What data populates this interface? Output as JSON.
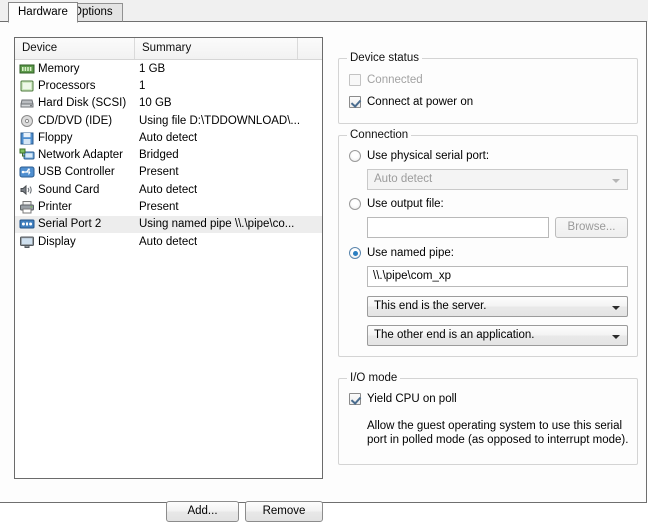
{
  "tabs": [
    {
      "label": "Hardware",
      "active": true
    },
    {
      "label": "Options",
      "active": false
    }
  ],
  "device_list": {
    "columns": [
      "Device",
      "Summary"
    ],
    "rows": [
      {
        "icon": "memory-icon",
        "device": "Memory",
        "summary": "1 GB"
      },
      {
        "icon": "processor-icon",
        "device": "Processors",
        "summary": "1"
      },
      {
        "icon": "hard-disk-icon",
        "device": "Hard Disk (SCSI)",
        "summary": "10 GB"
      },
      {
        "icon": "cd-dvd-icon",
        "device": "CD/DVD (IDE)",
        "summary": "Using file D:\\TDDOWNLOAD\\..."
      },
      {
        "icon": "floppy-icon",
        "device": "Floppy",
        "summary": "Auto detect"
      },
      {
        "icon": "network-adapter-icon",
        "device": "Network Adapter",
        "summary": "Bridged"
      },
      {
        "icon": "usb-controller-icon",
        "device": "USB Controller",
        "summary": "Present"
      },
      {
        "icon": "sound-card-icon",
        "device": "Sound Card",
        "summary": "Auto detect"
      },
      {
        "icon": "printer-icon",
        "device": "Printer",
        "summary": "Present"
      },
      {
        "icon": "serial-port-icon",
        "device": "Serial Port 2",
        "summary": "Using named pipe \\\\.\\pipe\\co...",
        "selected": true
      },
      {
        "icon": "display-icon",
        "device": "Display",
        "summary": "Auto detect"
      }
    ]
  },
  "buttons": {
    "add": "Add...",
    "remove": "Remove"
  },
  "device_status": {
    "legend": "Device status",
    "connected": {
      "label": "Connected",
      "checked": false,
      "enabled": false
    },
    "connect_at_power_on": {
      "label": "Connect at power on",
      "checked": true,
      "enabled": true
    }
  },
  "connection": {
    "legend": "Connection",
    "use_physical_serial_port": {
      "label": "Use physical serial port:",
      "selected": false
    },
    "physical_port_combo": {
      "value": "Auto detect",
      "enabled": false
    },
    "use_output_file": {
      "label": "Use output file:",
      "selected": false
    },
    "output_file_input": {
      "value": "",
      "enabled": false
    },
    "browse_button": {
      "label": "Browse...",
      "enabled": false
    },
    "use_named_pipe": {
      "label": "Use named pipe:",
      "selected": true
    },
    "named_pipe_input": {
      "value": "\\\\.\\pipe\\com_xp",
      "enabled": true
    },
    "near_end_combo": {
      "value": "This end is the server.",
      "enabled": true
    },
    "far_end_combo": {
      "value": "The other end is an application.",
      "enabled": true
    }
  },
  "io_mode": {
    "legend": "I/O mode",
    "yield_cpu": {
      "label": "Yield CPU on poll",
      "checked": true
    },
    "description": "Allow the guest operating system to use this serial port in polled mode (as opposed to interrupt mode)."
  },
  "colors": {
    "accent": "#2a7ec1",
    "panel_bg": "#fdfdfd",
    "selection": "#ededed"
  }
}
